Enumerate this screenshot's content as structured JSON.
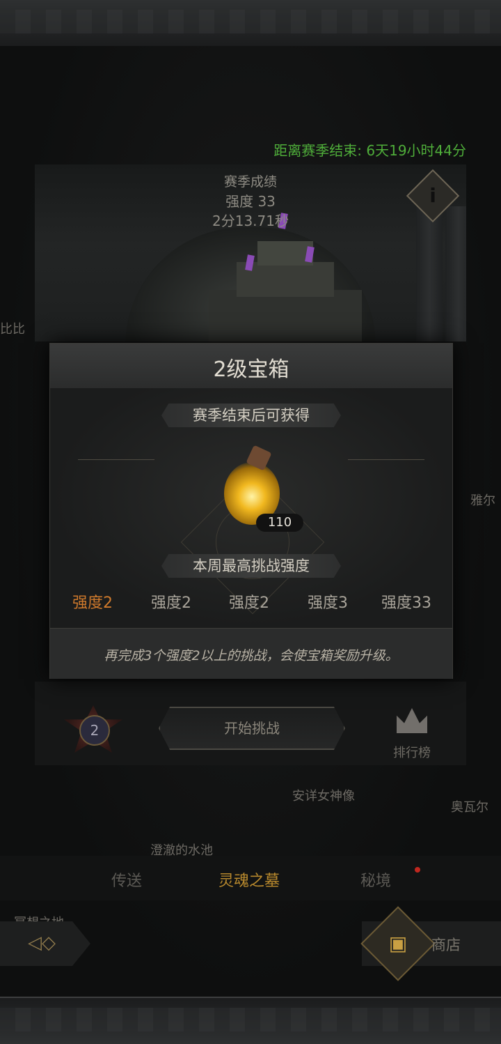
{
  "season": {
    "countdown": "距离赛季结束: 6天19小时44分",
    "result_title": "赛季成绩",
    "intensity": "强度 33",
    "best_time": "2分13.71秒",
    "info_icon": "i"
  },
  "side_labels": {
    "left_top": "比比",
    "right_mid": "雅尔",
    "statue": "安详女神像",
    "right_low": "奥瓦尔",
    "pool": "澄澈的水池",
    "left_low": "冥想之地"
  },
  "modal": {
    "title": "2级宝箱",
    "reward_caption": "赛季结束后可获得",
    "reward_item": "potion-icon",
    "reward_qty": "110",
    "weekly_caption": "本周最高挑战强度",
    "levels": [
      "强度2",
      "强度2",
      "强度2",
      "强度3",
      "强度33"
    ],
    "hint": "再完成3个强度2以上的挑战，会使宝箱奖励升级。"
  },
  "controls": {
    "badge_level": "2",
    "start_label": "开始挑战",
    "rank_label": "排行榜"
  },
  "nav": {
    "teleport": "传送",
    "soul_tomb": "灵魂之墓",
    "secret_realm": "秘境",
    "shop": "商店"
  },
  "colors": {
    "countdown": "#4fae3a",
    "active_level": "#d07a2c",
    "active_nav": "#b8892d",
    "notify_dot": "#c0271f"
  }
}
